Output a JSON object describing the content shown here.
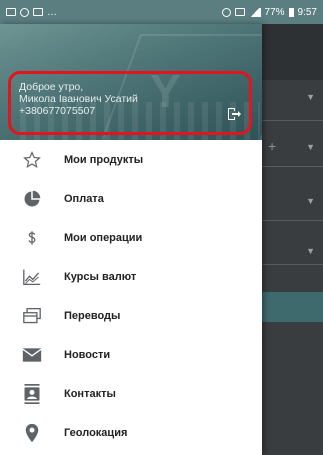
{
  "status_bar": {
    "battery_text": "77%",
    "time": "9:57"
  },
  "drawer": {
    "greeting": "Доброе утро,",
    "user_name": "Микола Іванович Усатий",
    "phone": "+380677075507",
    "header_watermark": "Y"
  },
  "menu": {
    "items": [
      {
        "label": "Мои продукты",
        "icon": "star-icon"
      },
      {
        "label": "Оплата",
        "icon": "pie-chart-icon"
      },
      {
        "label": "Мои операции",
        "icon": "dollar-icon"
      },
      {
        "label": "Курсы валют",
        "icon": "chart-line-icon"
      },
      {
        "label": "Переводы",
        "icon": "transfer-icon"
      },
      {
        "label": "Новости",
        "icon": "mail-icon"
      },
      {
        "label": "Контакты",
        "icon": "contacts-icon"
      },
      {
        "label": "Геолокация",
        "icon": "location-pin-icon"
      }
    ]
  },
  "colors": {
    "highlight_border": "#e2141d",
    "header_teal": "#4d7476",
    "icon_gray": "#5f6368"
  }
}
